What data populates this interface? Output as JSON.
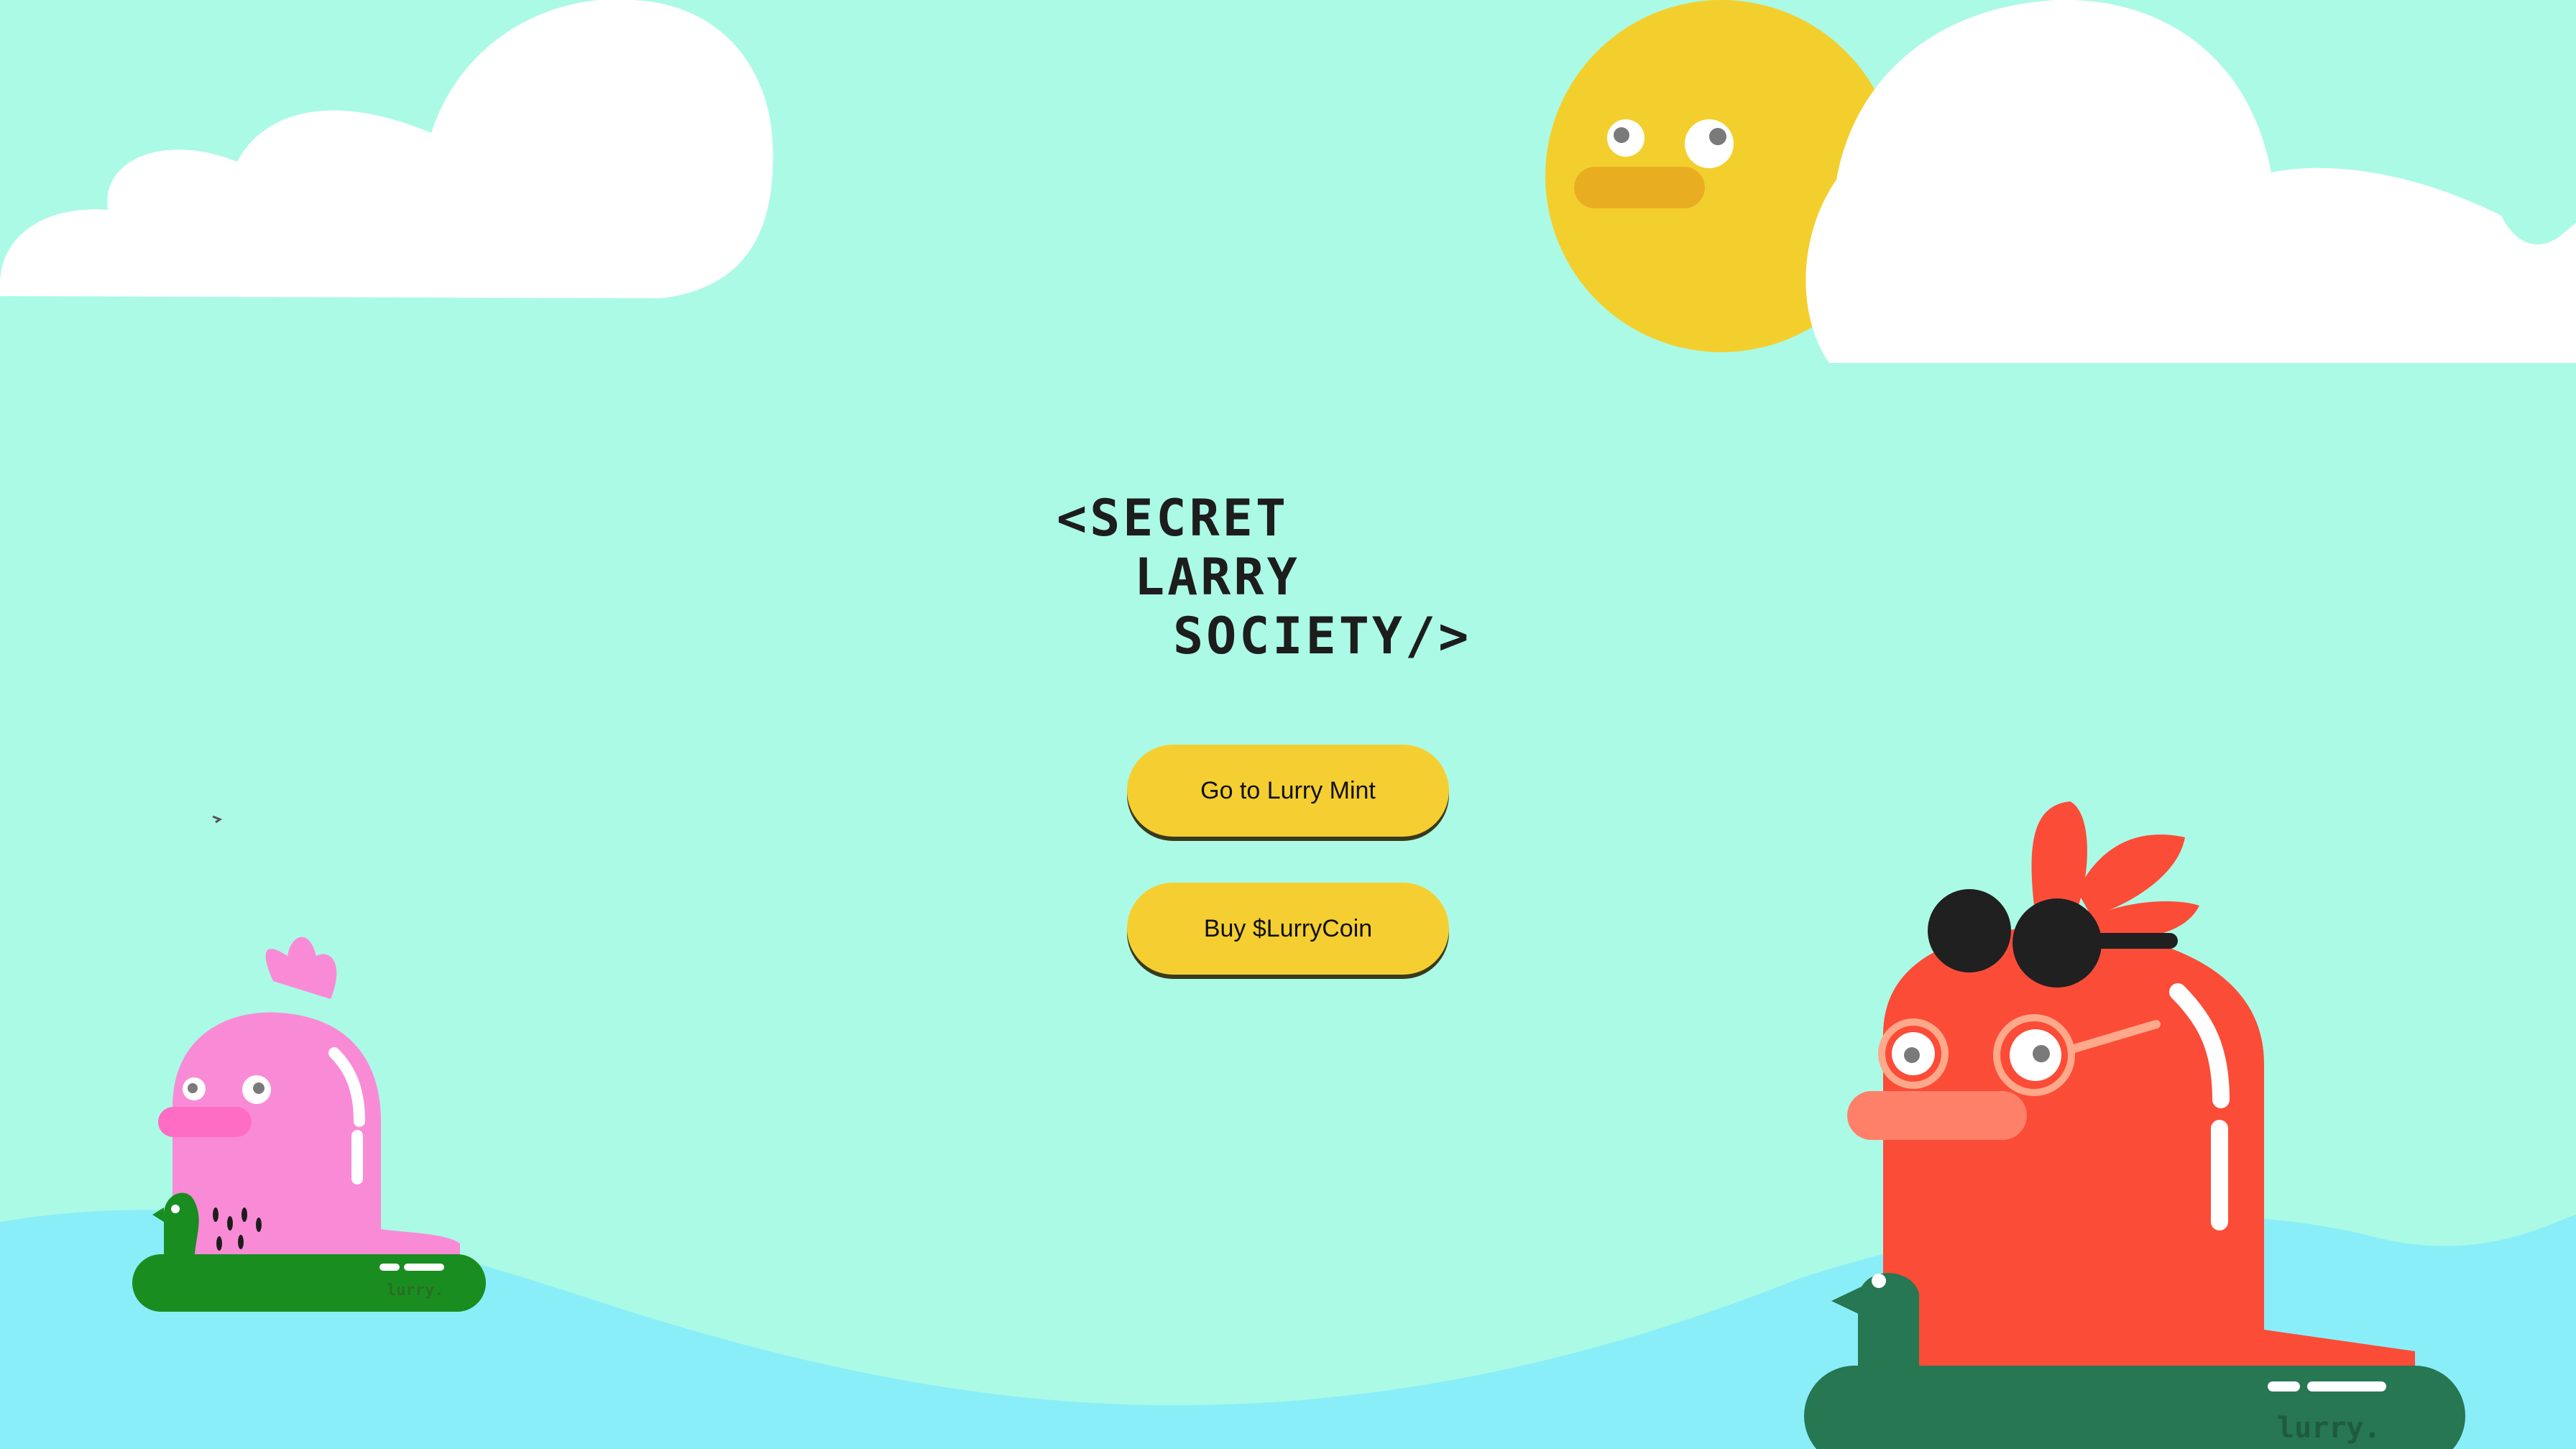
{
  "logo": {
    "line1": "<SECRET",
    "line2": "LARRY",
    "line3": "SOCIETY/>"
  },
  "buttons": {
    "mint_label": "Go to Lurry Mint",
    "coin_label": "Buy $LurryCoin"
  },
  "characters": {
    "float_brand": "lurry."
  },
  "colors": {
    "sky": "#abfae6",
    "water": "#8aeef8",
    "sun": "#f3cf2e",
    "button": "#f5cf31",
    "pink_character": "#f98bd6",
    "red_character": "#fb4c38",
    "green_float": "#1a8d21",
    "teal_float": "#267752"
  }
}
